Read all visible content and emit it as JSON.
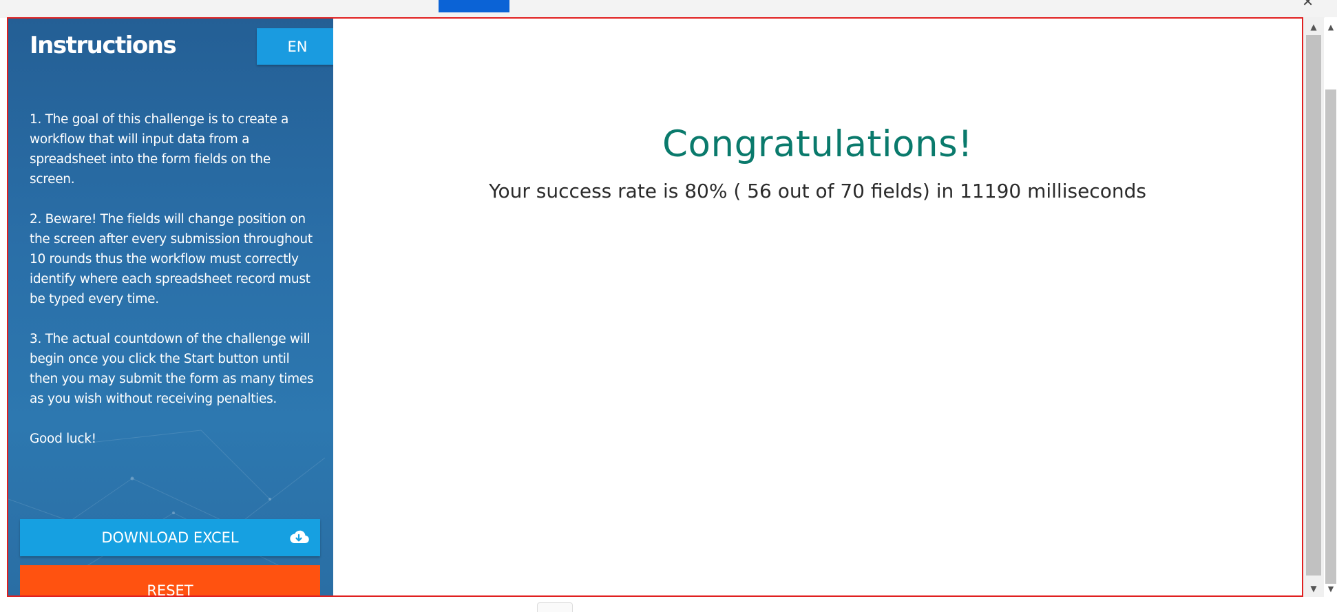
{
  "sidebar": {
    "title": "Instructions",
    "language_button": "EN",
    "instructions": [
      "1. The goal of this challenge is to create a workflow that will input data from a spreadsheet into the form fields on the screen.",
      "2. Beware! The fields will change position on the screen after every submission throughout 10 rounds thus the workflow must correctly identify where each spreadsheet record must be typed every time.",
      "3. The actual countdown of the challenge will begin once you click the Start button until then you may submit the form as many times as you wish without receiving penalties.",
      "Good luck!"
    ],
    "download_button": "DOWNLOAD EXCEL",
    "reset_button": "RESET"
  },
  "main": {
    "heading": "Congratulations!",
    "result": "Your success rate is 80% ( 56 out of 70 fields) in 11190 milliseconds"
  },
  "colors": {
    "sidebar_bg": "#2a6fa8",
    "accent_blue": "#16a0e1",
    "reset_orange": "#ff5210",
    "heading_teal": "#0a7a6c",
    "frame_border": "#e02020"
  },
  "icons": {
    "download": "cloud-download-icon",
    "close": "close-icon",
    "scroll_up": "arrow-up-icon",
    "scroll_down": "arrow-down-icon"
  }
}
